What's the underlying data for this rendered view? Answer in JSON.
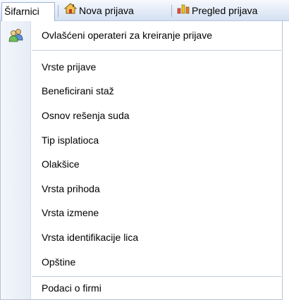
{
  "menubar": {
    "items": [
      {
        "label": "Šifarnici",
        "icon": "none"
      },
      {
        "label": "Nova prijava",
        "icon": "home-icon"
      },
      {
        "label": "Pregled prijava",
        "icon": "bar-chart-icon"
      }
    ]
  },
  "dropdown": {
    "items": [
      {
        "label": "Ovlašćeni operateri za kreiranje prijave",
        "icon": "users-icon"
      },
      {
        "label": "Vrste prijave"
      },
      {
        "label": "Beneficirani staž"
      },
      {
        "label": "Osnov rešenja suda"
      },
      {
        "label": "Tip isplatioca"
      },
      {
        "label": "Olakšice"
      },
      {
        "label": "Vrsta prihoda"
      },
      {
        "label": "Vrsta izmene"
      },
      {
        "label": "Vrsta identifikacije lica"
      },
      {
        "label": "Opštine"
      },
      {
        "label": "Podaci o firmi"
      }
    ]
  },
  "colors": {
    "menubar_bg": "#dbe6f5",
    "gutter_bg": "#e9eef7",
    "separator": "#c5cbd6"
  }
}
